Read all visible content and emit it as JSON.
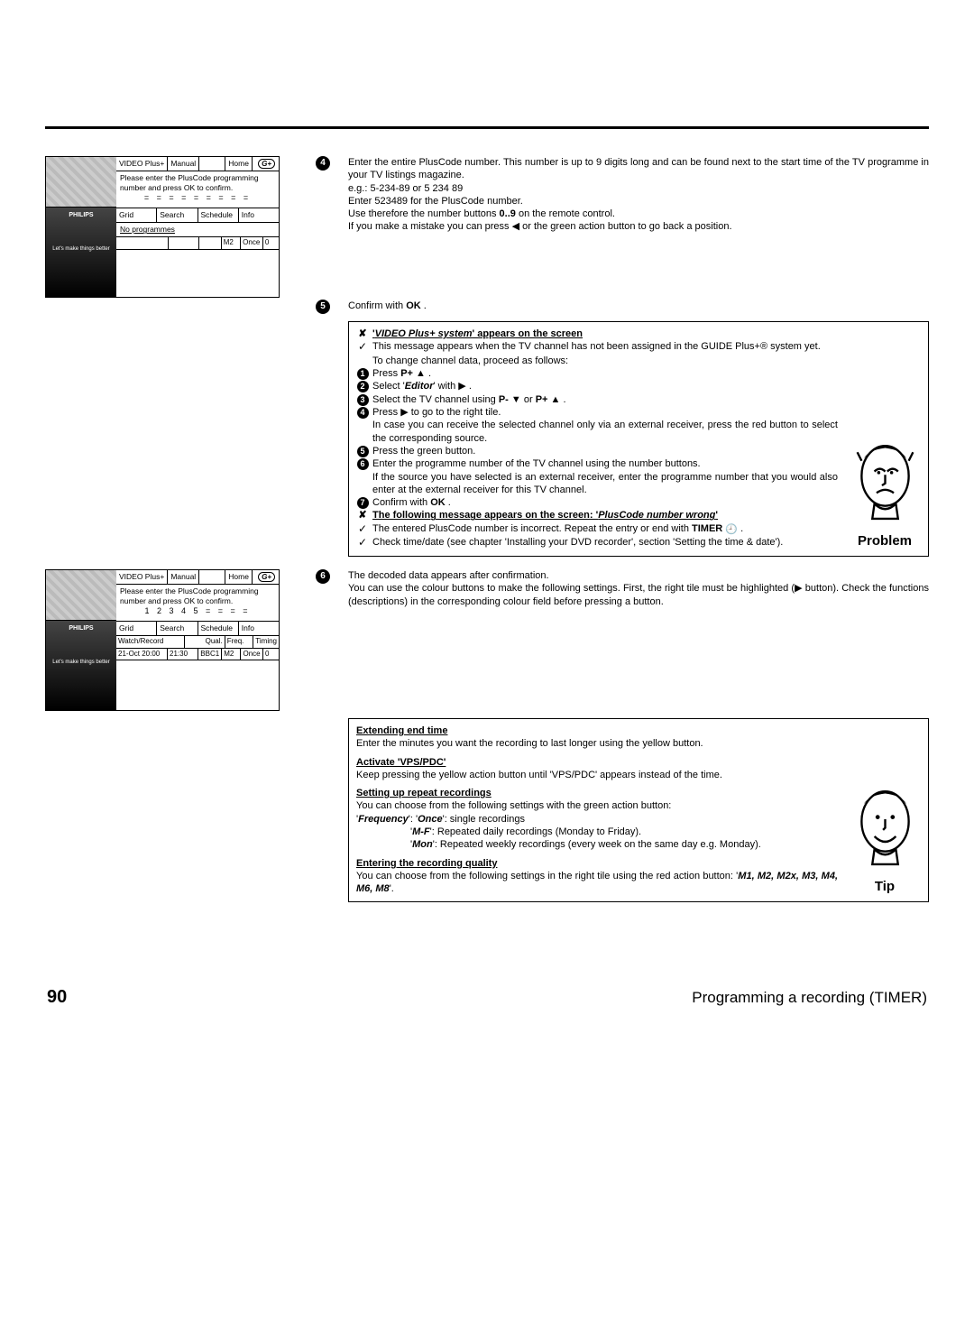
{
  "osd_common": {
    "top_tabs": [
      "VIDEO Plus+",
      "Manual"
    ],
    "home": "Home",
    "msg": "Please enter the PlusCode programming number and press OK to confirm.",
    "mid_tabs": [
      "Grid",
      "Search",
      "Schedule",
      "Info"
    ],
    "ad_brand": "PHILIPS",
    "ad_tag": "Let's make things better"
  },
  "osd1": {
    "entry": "= = = = = = = = =",
    "no_programmes": "No programmes",
    "row": {
      "m": "M2",
      "freq": "Once",
      "t": "0"
    }
  },
  "osd2": {
    "entry": "1 2 3 4 5 = = = =",
    "hdr": {
      "wr": "Watch/Record",
      "qual": "Qual.",
      "freq": "Freq.",
      "tim": "Timing"
    },
    "row": {
      "wr": "21-Oct  20:00",
      "end": "21:30",
      "ch": "BBC1",
      "qual": "M2",
      "freq": "Once",
      "tim": "0"
    }
  },
  "step4": {
    "p1": "Enter the entire PlusCode number. This number is up to 9 digits long and can be found next to the start time of the TV programme in your TV listings magazine.",
    "eg": "e.g.: 5-234-89 or 5 234 89",
    "enter": "Enter 523489 for the PlusCode number.",
    "use_a": "Use therefore the number buttons ",
    "use_b": "0..9",
    "use_c": " on the remote control.",
    "mistake_a": "If you make a mistake you can press ",
    "mistake_b": " or the green action button to go back a position."
  },
  "step5": {
    "txt_a": "Confirm with ",
    "txt_b": "OK",
    "txt_c": " ."
  },
  "problem": {
    "title1_a": "'",
    "title1_b": "VIDEO Plus+ system",
    "title1_c": "' appears on the screen",
    "msg_a": "This message appears when the TV channel has not been assigned in the GUIDE Plus+® system yet.",
    "msg_b": "To change channel data, proceed as follows:",
    "s1_a": "Press ",
    "s1_b": "P+",
    "s1_c": " .",
    "s2_a": "Select '",
    "s2_b": "Editor",
    "s2_c": "' with ",
    "s2_d": " .",
    "s3_a": "Select the TV channel using ",
    "s3_b": "P-",
    "s3_c": " or ",
    "s3_d": "P+",
    "s3_e": " .",
    "s4_a": "Press ",
    "s4_b": " to go to the right tile.",
    "s4_c": "In case you can receive the selected channel only via an external receiver, press the red button to select the corresponding source.",
    "s5": "Press the green button.",
    "s6_a": "Enter the programme number of the TV channel using the number buttons.",
    "s6_b": "If the source you have selected is an external receiver, enter the programme number that you would also enter at the external receiver for this TV channel.",
    "s7_a": "Confirm with ",
    "s7_b": "OK",
    "s7_c": " .",
    "title2_a": "The following message appears on the screen: '",
    "title2_b": "PlusCode number wrong",
    "title2_c": "'",
    "entwrong_a": "The entered PlusCode number is incorrect. Repeat the entry or end with ",
    "entwrong_b": "TIMER",
    "chk": "Check time/date (see chapter 'Installing your DVD recorder', section 'Setting the time & date').",
    "facelabel": "Problem"
  },
  "step6": {
    "p_a": "The decoded data appears after confirmation.",
    "p_b": "You can use the colour buttons to make the following settings. First, the right tile must be highlighted (",
    "p_c": " button). Check the functions (descriptions) in the corresponding colour field before pressing a button."
  },
  "tip": {
    "t1": "Extending end time",
    "t1_txt": "Enter the minutes you want the recording to last longer using the yellow button.",
    "t2": "Activate 'VPS/PDC'",
    "t2_txt": "Keep pressing the yellow action button until 'VPS/PDC' appears instead of the time.",
    "t3": "Setting up repeat recordings",
    "t3_txt": "You can choose from the following settings with the green action button:",
    "f_label_a": "'",
    "f_label_b": "Frequency",
    "f_label_c": "':",
    "f_once_a": "'",
    "f_once_b": "Once",
    "f_once_c": "': single recordings",
    "f_mf_a": "'",
    "f_mf_b": "M-F",
    "f_mf_c": "': Repeated daily recordings (Monday to Friday).",
    "f_mon_a": "'",
    "f_mon_b": "Mon",
    "f_mon_c": "': Repeated weekly recordings (every week on the same day e.g. Monday).",
    "t4": "Entering the recording quality",
    "t4_txt_a": "You can choose from the following settings in the right tile using the red action button: '",
    "t4_txt_b": "M1, M2, M2x, M3, M4, M6, M8",
    "t4_txt_c": "'.",
    "facelabel": "Tip"
  },
  "footer": {
    "pagenum": "90",
    "title": "Programming a recording (TIMER)"
  }
}
